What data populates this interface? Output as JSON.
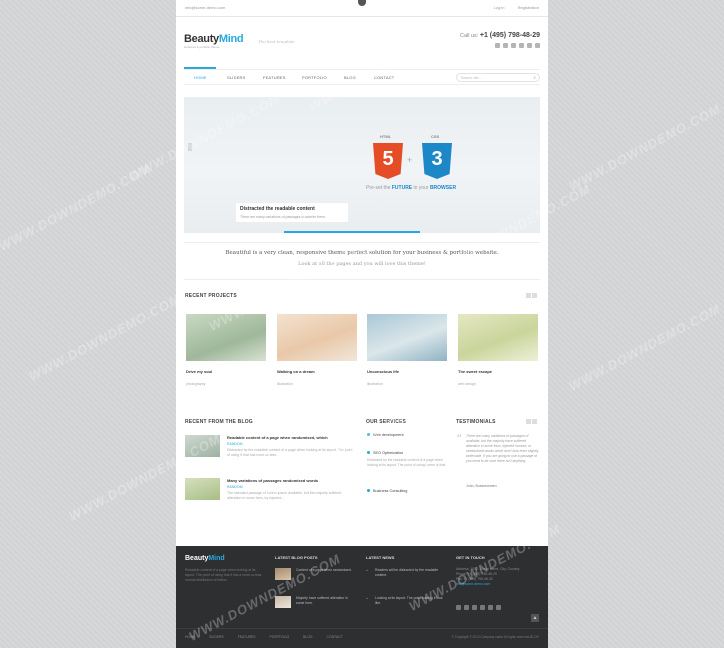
{
  "topbar": {
    "email": "info@some-demo.com",
    "login": "Log in",
    "register": "Registration"
  },
  "header": {
    "logo_part1": "Beauty",
    "logo_part2": "Mind",
    "logo_tagline": "business & portfolio theme",
    "slogan": "The best template",
    "phone_label": "Call us:",
    "phone_number": "+1 (495) 798-48-29"
  },
  "nav": {
    "items": [
      "HOME",
      "SLIDERS",
      "FEATURES",
      "PORTFOLIO",
      "BLOG",
      "CONTACT"
    ],
    "search_placeholder": "Search site..."
  },
  "slider": {
    "html_label": "HTML",
    "css_label": "CSS",
    "html_number": "5",
    "css_number": "3",
    "plus": "+",
    "subtitle_pre": "Pre-set the",
    "subtitle_future": "FUTURE",
    "subtitle_mid": "in your",
    "subtitle_browser": "BROWSER",
    "caption_title": "Distracted the readable content",
    "caption_desc": "There are many variations of passages to admire them."
  },
  "intro": {
    "line1": "Beautiful is a very clean, responsive theme perfect solution for your business & portfolio website.",
    "line2": "Look at all the pages and you will love this theme!"
  },
  "recent_projects": {
    "title": "RECENT PROJECTS",
    "items": [
      {
        "name": "Drive my soul",
        "category": "photography"
      },
      {
        "name": "Walking on a dream",
        "category": "illustration"
      },
      {
        "name": "Unconscious life",
        "category": "illustration"
      },
      {
        "name": "The sweet escape",
        "category": "web design"
      }
    ]
  },
  "blog": {
    "title": "RECENT FROM THE BLOG",
    "items": [
      {
        "title": "Readable content of a page when randomised, which",
        "meta": "RANDOM",
        "excerpt": "Distracted by the readable content of a page when looking at its layout. The point of using it that has more-or-less."
      },
      {
        "title": "Many variations of passages randomised words",
        "meta": "RANDOM",
        "excerpt": "The standard passage of Lorem Ipsum available, but the majority suffered alteration in some form, by injected..."
      }
    ]
  },
  "services": {
    "title": "OUR SERVICES",
    "items": [
      {
        "name": "Web development",
        "desc": ""
      },
      {
        "name": "SEO Optimization",
        "desc": "Distracted by the readable content of a page when looking at its layout. The point of using Lorem is that."
      },
      {
        "name": "Business Consulting",
        "desc": ""
      }
    ]
  },
  "testimonials": {
    "title": "TESTIMONIALS",
    "quote_mark": "“",
    "text": "There are many variations of passages of available, but the majority have suffered alteration in some form, injected humour, or randomised words which don't look even slightly believable. If you are going to use a passage of you need to be sure there isn't anything.",
    "author": "John, Businessmen"
  },
  "footer": {
    "logo_part1": "Beauty",
    "logo_part2": "Mind",
    "about": "Readable content of a page when looking at its layout. The point of using that it has a more-or-less normal distribution of letters.",
    "latest_posts_title": "LATEST BLOG POSTS",
    "latest_posts": [
      "Content of a page when randomised.",
      "Majority have suffered alteration in some form."
    ],
    "latest_news_title": "LATEST NEWS",
    "latest_news": [
      "Readers will be distracted by the readable content.",
      "Looking at its layout. The point making it look like."
    ],
    "contact_title": "GET IN TOUCH",
    "contact_address": "Address: 1002, Street name, City, Country",
    "contact_phone": "Phone: +1 (495) 798-48-29",
    "contact_fax": "Fax: +1 (495) 798-48-30",
    "contact_email": "info@some-demo.com",
    "to_top": "▲",
    "bottom_nav": [
      "HOME",
      "SLIDERS",
      "FEATURES",
      "PORTFOLIO",
      "BLOG",
      "CONTACT"
    ],
    "copyright": "© Copyright © 2013 Company name All rights reserved.BLOG"
  },
  "watermark": "WWW.DOWNDEMO.COM",
  "colors": {
    "accent": "#29a8dd",
    "html5": "#e44d26",
    "css3": "#1c88c7",
    "footer_bg": "#2e2f31"
  }
}
